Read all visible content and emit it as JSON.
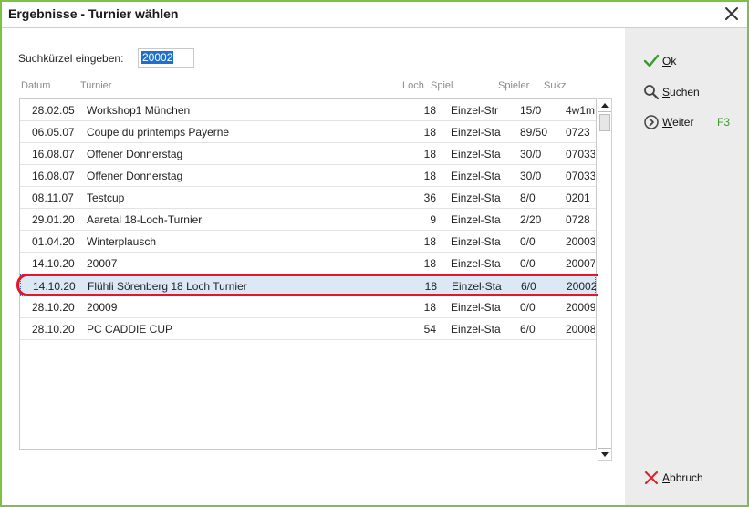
{
  "window": {
    "title": "Ergebnisse - Turnier wählen"
  },
  "search": {
    "label": "Suchkürzel eingeben:",
    "value": "20002"
  },
  "columns": [
    "Datum",
    "Turnier",
    "Loch",
    "Spiel",
    "Spieler",
    "Sukz"
  ],
  "rows": [
    {
      "datum": "28.02.05",
      "turnier": "Workshop1 München",
      "loch": "18",
      "spiel": "Einzel-Str",
      "spieler": "15/0",
      "sukz": "4w1m"
    },
    {
      "datum": "06.05.07",
      "turnier": "Coupe du printemps Payerne",
      "loch": "18",
      "spiel": "Einzel-Sta",
      "spieler": "89/50",
      "sukz": "0723"
    },
    {
      "datum": "16.08.07",
      "turnier": "Offener Donnerstag",
      "loch": "18",
      "spiel": "Einzel-Sta",
      "spieler": "30/0",
      "sukz": "07033"
    },
    {
      "datum": "16.08.07",
      "turnier": "Offener Donnerstag",
      "loch": "18",
      "spiel": "Einzel-Sta",
      "spieler": "30/0",
      "sukz": "07033"
    },
    {
      "datum": "08.11.07",
      "turnier": "Testcup",
      "loch": "36",
      "spiel": "Einzel-Sta",
      "spieler": "8/0",
      "sukz": "0201"
    },
    {
      "datum": "29.01.20",
      "turnier": "Aaretal 18-Loch-Turnier",
      "loch": "9",
      "spiel": "Einzel-Sta",
      "spieler": "2/20",
      "sukz": "0728"
    },
    {
      "datum": "01.04.20",
      "turnier": "Winterplausch",
      "loch": "18",
      "spiel": "Einzel-Sta",
      "spieler": "0/0",
      "sukz": "20003"
    },
    {
      "datum": "14.10.20",
      "turnier": "20007",
      "loch": "18",
      "spiel": "Einzel-Sta",
      "spieler": "0/0",
      "sukz": "20007"
    },
    {
      "datum": "14.10.20",
      "turnier": "Flühli Sörenberg 18 Loch Turnier",
      "loch": "18",
      "spiel": "Einzel-Sta",
      "spieler": "6/0",
      "sukz": "20002",
      "selected": true
    },
    {
      "datum": "28.10.20",
      "turnier": "20009",
      "loch": "18",
      "spiel": "Einzel-Sta",
      "spieler": "0/0",
      "sukz": "20009"
    },
    {
      "datum": "28.10.20",
      "turnier": "PC CADDIE CUP",
      "loch": "54",
      "spiel": "Einzel-Sta",
      "spieler": "6/0",
      "sukz": "20008"
    }
  ],
  "actions": {
    "ok": {
      "first": "O",
      "rest": "k",
      "icon": "check-icon",
      "color": "#3a9b2a"
    },
    "suchen": {
      "first": "S",
      "rest": "uchen",
      "icon": "magnifier-icon"
    },
    "weiter": {
      "first": "W",
      "rest": "eiter",
      "icon": "chevron-circle-icon",
      "hotkey": "F3"
    },
    "abbruch": {
      "first": "A",
      "rest": "bbruch",
      "icon": "cross-icon",
      "color": "#d9262e"
    }
  },
  "colors": {
    "window_border": "#7cc13f",
    "selection_ring": "#e5152a",
    "selection_bg": "#dbe8f6",
    "input_highlight": "#1f6fcf"
  }
}
